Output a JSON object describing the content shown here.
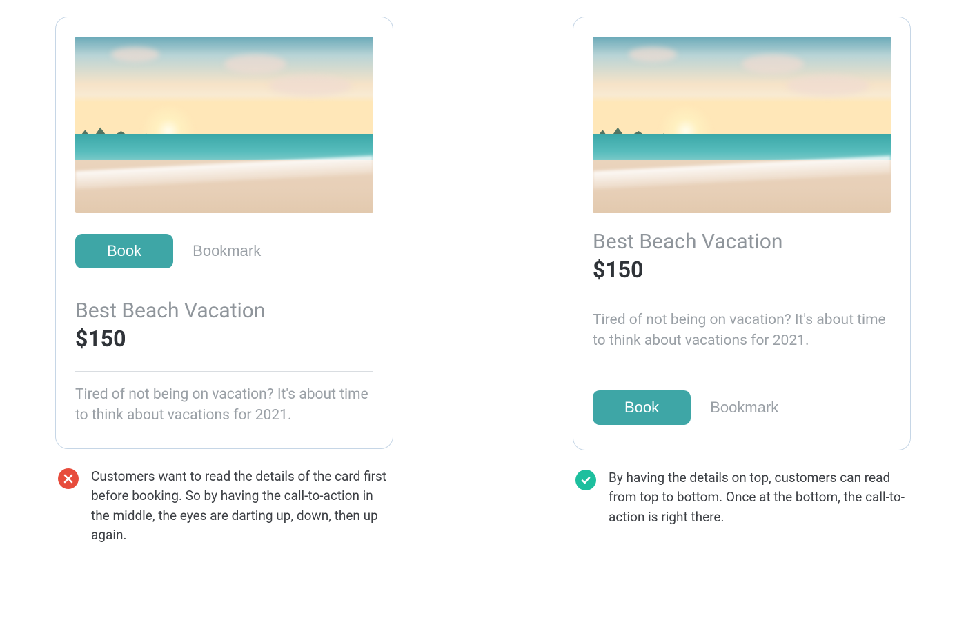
{
  "colors": {
    "accent": "#3ea6a6",
    "bad": "#e74c3c",
    "good": "#1dbf9e"
  },
  "card": {
    "title": "Best Beach Vacation",
    "price": "$150",
    "description": "Tired of not being on vacation? It's about time to think about vacations for 2021.",
    "book_label": "Book",
    "bookmark_label": "Bookmark"
  },
  "notes": {
    "bad": "Customers want to read the details of the card first before booking. So by having the call-to-action in the middle, the eyes are darting up, down, then up again.",
    "good": "By having the details on top, customers can read from top to bottom. Once at the bottom, the call-to-action is right there."
  }
}
